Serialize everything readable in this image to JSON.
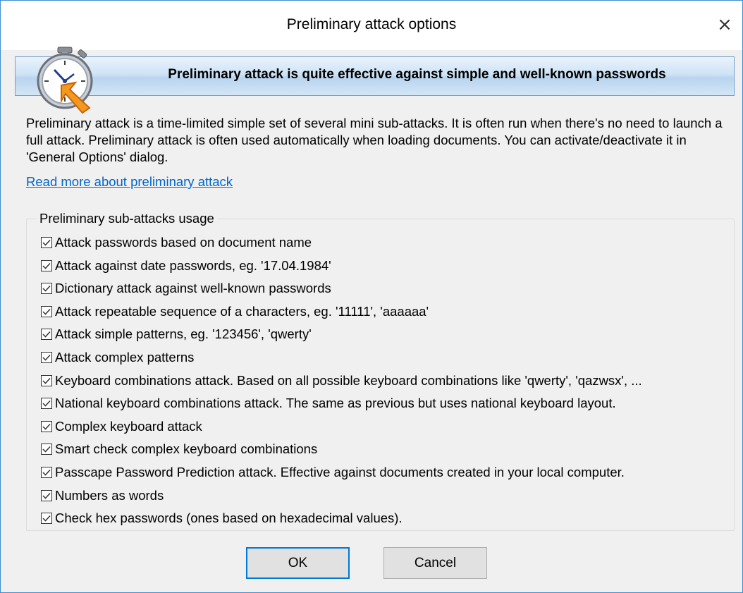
{
  "window": {
    "title": "Preliminary attack options",
    "close_glyph": "×"
  },
  "banner": {
    "text": "Preliminary attack is quite effective against simple and well-known passwords",
    "icon": "stopwatch-icon"
  },
  "description": "Preliminary attack is a time-limited simple set of several mini sub-attacks. It is often run when there's no need to launch a full attack. Preliminary attack is often used automatically when loading documents. You can activate/deactivate it in 'General Options' dialog.",
  "read_more_link": "Read more about preliminary attack",
  "group": {
    "legend": "Preliminary sub-attacks usage",
    "options": [
      {
        "label": "Attack passwords based on document name",
        "checked": true
      },
      {
        "label": "Attack against date passwords, eg. '17.04.1984'",
        "checked": true
      },
      {
        "label": "Dictionary attack against well-known passwords",
        "checked": true
      },
      {
        "label": "Attack repeatable sequence of a characters, eg. '11111', 'aaaaaa'",
        "checked": true
      },
      {
        "label": "Attack simple patterns, eg. '123456', 'qwerty'",
        "checked": true
      },
      {
        "label": "Attack complex patterns",
        "checked": true
      },
      {
        "label": "Keyboard combinations attack. Based on all possible keyboard combinations like 'qwerty', 'qazwsx', ...",
        "checked": true
      },
      {
        "label": "National keyboard combinations attack. The same as previous but uses national keyboard layout.",
        "checked": true
      },
      {
        "label": "Complex keyboard attack",
        "checked": true
      },
      {
        "label": "Smart check complex keyboard combinations",
        "checked": true
      },
      {
        "label": "Passcape Password Prediction attack. Effective against documents created in your local computer.",
        "checked": true
      },
      {
        "label": "Numbers as words",
        "checked": true
      },
      {
        "label": "Check hex passwords (ones based on hexadecimal values).",
        "checked": true
      }
    ]
  },
  "buttons": {
    "ok": "OK",
    "cancel": "Cancel"
  },
  "colors": {
    "accent": "#0078d7",
    "link": "#0066cc",
    "window_border": "#3c8ed1"
  }
}
